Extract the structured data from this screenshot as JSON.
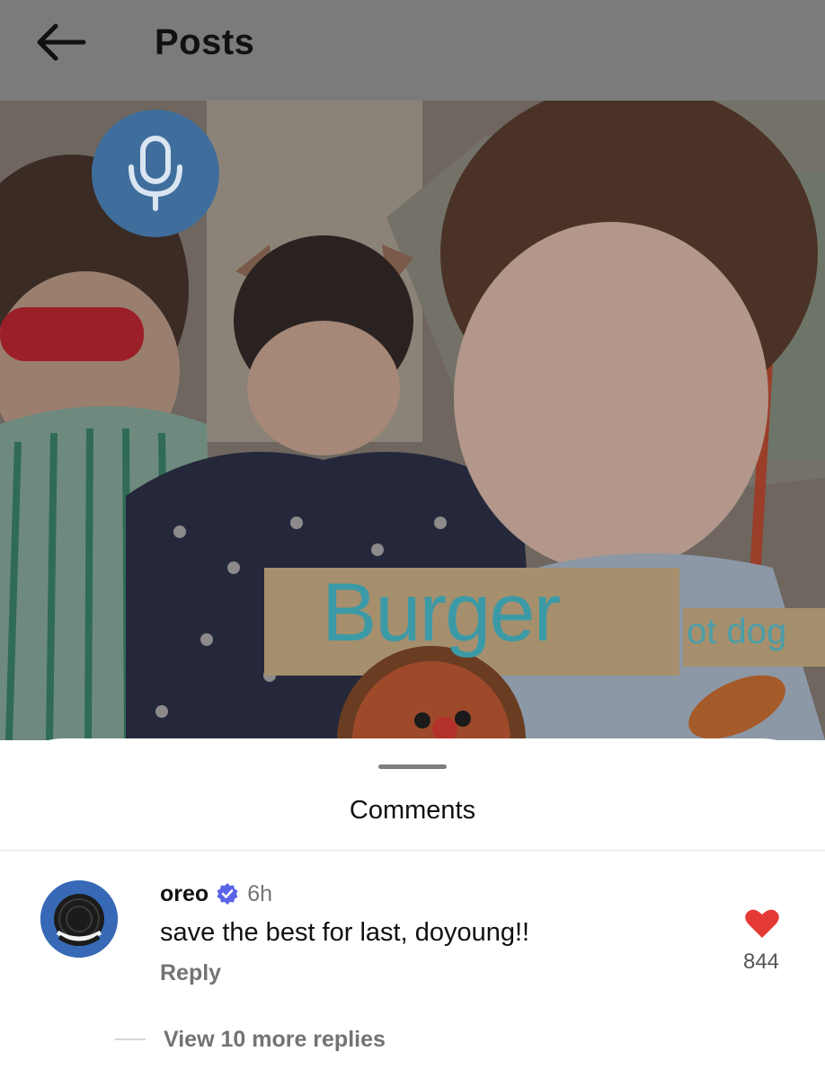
{
  "header": {
    "title": "Posts",
    "back_icon": "arrow-left-icon"
  },
  "media": {
    "mic_icon": "microphone-icon",
    "mic_color": "#3f6e9c",
    "caption_primary": "Burger",
    "caption_secondary": "ot dog"
  },
  "sheet": {
    "title": "Comments"
  },
  "comment": {
    "username": "oreo",
    "verified": true,
    "time": "6h",
    "text": "save the best for last, doyoung!!",
    "reply_label": "Reply",
    "like_count": "844",
    "like_color": "#e53935",
    "more_replies": "View 10 more replies"
  }
}
